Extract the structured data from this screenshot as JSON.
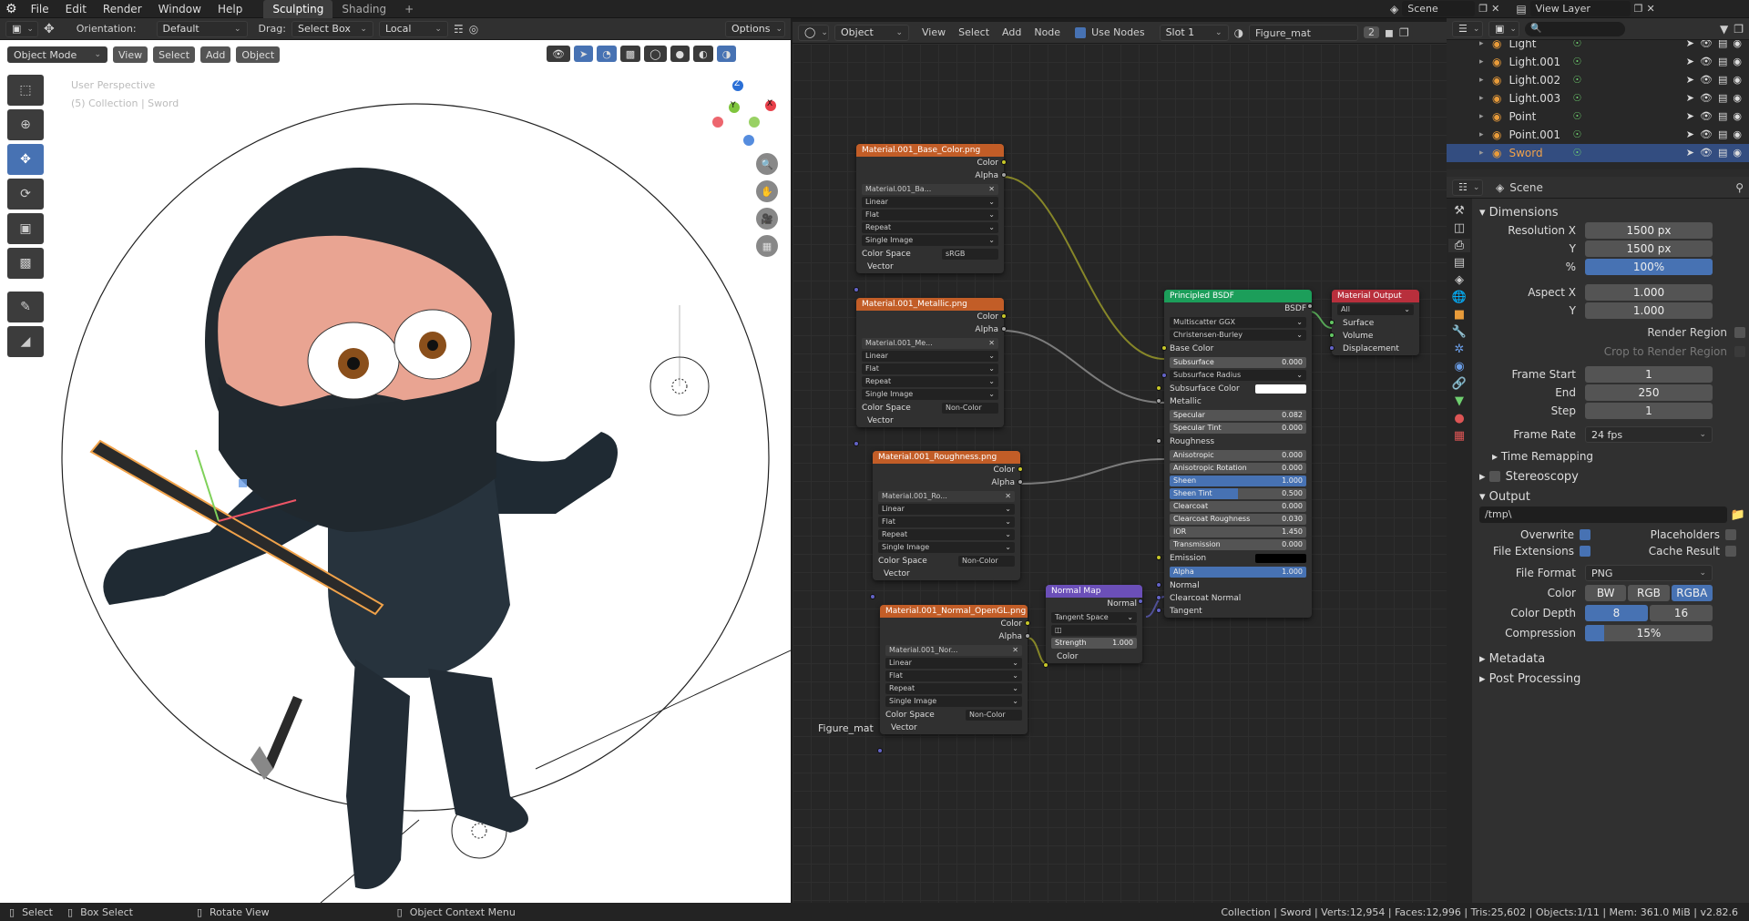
{
  "topbar": {
    "menus": [
      "File",
      "Edit",
      "Render",
      "Window",
      "Help"
    ],
    "workspace_tabs": [
      "Sculpting",
      "Shading"
    ],
    "active_tab": "Sculpting",
    "scene_label": "Scene",
    "view_layer_label": "View Layer"
  },
  "viewport_header": {
    "orientation_label": "Orientation:",
    "orientation_value": "Default",
    "drag_label": "Drag:",
    "drag_value": "Select Box",
    "pivot_value": "Local",
    "options_label": "Options",
    "mode": "Object Mode",
    "menus": [
      "View",
      "Select",
      "Add",
      "Object"
    ]
  },
  "viewport": {
    "overlay_line1": "User Perspective",
    "overlay_line2": "(5) Collection | Sword",
    "gizmo_axes": [
      "Z",
      "Y",
      "X"
    ]
  },
  "node_header": {
    "object_value": "Object",
    "menus": [
      "View",
      "Select",
      "Add",
      "Node"
    ],
    "use_nodes_label": "Use Nodes",
    "slot_value": "Slot 1",
    "material_name": "Figure_mat",
    "user_count": "2"
  },
  "node_editor": {
    "footer_label": "Figure_mat",
    "image_nodes": [
      {
        "title": "Material.001_Base_Color.png",
        "image": "Material.001_Ba...",
        "interp": "Linear",
        "proj": "Flat",
        "ext": "Repeat",
        "src": "Single Image",
        "cs_label": "Color Space",
        "cs": "sRGB",
        "vector": "Vector",
        "out1": "Color",
        "out2": "Alpha"
      },
      {
        "title": "Material.001_Metallic.png",
        "image": "Material.001_Me...",
        "interp": "Linear",
        "proj": "Flat",
        "ext": "Repeat",
        "src": "Single Image",
        "cs_label": "Color Space",
        "cs": "Non-Color",
        "vector": "Vector",
        "out1": "Color",
        "out2": "Alpha"
      },
      {
        "title": "Material.001_Roughness.png",
        "image": "Material.001_Ro...",
        "interp": "Linear",
        "proj": "Flat",
        "ext": "Repeat",
        "src": "Single Image",
        "cs_label": "Color Space",
        "cs": "Non-Color",
        "vector": "Vector",
        "out1": "Color",
        "out2": "Alpha"
      },
      {
        "title": "Material.001_Normal_OpenGL.png",
        "image": "Material.001_Nor...",
        "interp": "Linear",
        "proj": "Flat",
        "ext": "Repeat",
        "src": "Single Image",
        "cs_label": "Color Space",
        "cs": "Non-Color",
        "vector": "Vector",
        "out1": "Color",
        "out2": "Alpha"
      }
    ],
    "bsdf": {
      "title": "Principled BSDF",
      "out": "BSDF",
      "dist": "Multiscatter GGX",
      "sss_method": "Christensen-Burley",
      "base_color": "Base Color",
      "rows": [
        {
          "label": "Subsurface",
          "value": "0.000",
          "type": "bar"
        },
        {
          "label": "Subsurface Radius",
          "value": "",
          "type": "dd"
        },
        {
          "label": "Subsurface Color",
          "value": "",
          "type": "white"
        },
        {
          "label": "Metallic",
          "value": "",
          "type": "label"
        },
        {
          "label": "Specular",
          "value": "0.082",
          "type": "bar"
        },
        {
          "label": "Specular Tint",
          "value": "0.000",
          "type": "bar"
        },
        {
          "label": "Roughness",
          "value": "",
          "type": "label"
        },
        {
          "label": "Anisotropic",
          "value": "0.000",
          "type": "bar"
        },
        {
          "label": "Anisotropic Rotation",
          "value": "0.000",
          "type": "bar"
        },
        {
          "label": "Sheen",
          "value": "1.000",
          "type": "blue"
        },
        {
          "label": "Sheen Tint",
          "value": "0.500",
          "type": "half"
        },
        {
          "label": "Clearcoat",
          "value": "0.000",
          "type": "bar"
        },
        {
          "label": "Clearcoat Roughness",
          "value": "0.030",
          "type": "bar"
        },
        {
          "label": "IOR",
          "value": "1.450",
          "type": "bar"
        },
        {
          "label": "Transmission",
          "value": "0.000",
          "type": "bar"
        },
        {
          "label": "Emission",
          "value": "",
          "type": "black"
        },
        {
          "label": "Alpha",
          "value": "1.000",
          "type": "blue"
        },
        {
          "label": "Normal",
          "value": "",
          "type": "label"
        },
        {
          "label": "Clearcoat Normal",
          "value": "",
          "type": "label"
        },
        {
          "label": "Tangent",
          "value": "",
          "type": "label"
        }
      ]
    },
    "output": {
      "title": "Material Output",
      "target": "All",
      "in": [
        "Surface",
        "Volume",
        "Displacement"
      ]
    },
    "normal_map": {
      "title": "Normal Map",
      "out": "Normal",
      "space": "Tangent Space",
      "strength_label": "Strength",
      "strength": "1.000",
      "in": "Color"
    }
  },
  "outliner": {
    "rows": [
      {
        "name": "Light"
      },
      {
        "name": "Light.001"
      },
      {
        "name": "Light.002"
      },
      {
        "name": "Light.003"
      },
      {
        "name": "Point"
      },
      {
        "name": "Point.001"
      },
      {
        "name": "Sword"
      }
    ],
    "selected": "Sword"
  },
  "properties": {
    "context": "Scene",
    "dimensions_label": "Dimensions",
    "res_x_label": "Resolution X",
    "res_x": "1500 px",
    "res_y_label": "Y",
    "res_y": "1500 px",
    "pct_label": "%",
    "pct": "100%",
    "aspect_x_label": "Aspect X",
    "aspect_x": "1.000",
    "aspect_y_label": "Y",
    "aspect_y": "1.000",
    "render_region": "Render Region",
    "crop_region": "Crop to Render Region",
    "frame_start_label": "Frame Start",
    "frame_start": "1",
    "end_label": "End",
    "end": "250",
    "step_label": "Step",
    "step": "1",
    "frame_rate_label": "Frame Rate",
    "frame_rate": "24 fps",
    "time_remap": "Time Remapping",
    "stereoscopy": "Stereoscopy",
    "output_label": "Output",
    "output_path": "/tmp\\",
    "overwrite": "Overwrite",
    "placeholders": "Placeholders",
    "file_ext": "File Extensions",
    "cache_result": "Cache Result",
    "file_format_label": "File Format",
    "file_format": "PNG",
    "color_label": "Color",
    "color_opts": [
      "BW",
      "RGB",
      "RGBA"
    ],
    "color_selected": "RGBA",
    "depth_label": "Color Depth",
    "depth_opts": [
      "8",
      "16"
    ],
    "compression_label": "Compression",
    "compression": "15%",
    "metadata": "Metadata",
    "post_processing": "Post Processing"
  },
  "statusbar": {
    "select": "Select",
    "box_select": "Box Select",
    "rotate": "Rotate View",
    "context_menu": "Object Context Menu",
    "stats": "Collection | Sword | Verts:12,954 | Faces:12,996 | Tris:25,602 | Objects:1/11 | Mem: 361.0 MiB | v2.82.6"
  },
  "colors": {
    "accent": "#4772b3",
    "image_node_header": "#c25d27",
    "bsdf_header": "#1c9e5a",
    "output_header": "#b82f3c",
    "vector_header": "#6b4fb8",
    "selection": "#f0a24a"
  }
}
